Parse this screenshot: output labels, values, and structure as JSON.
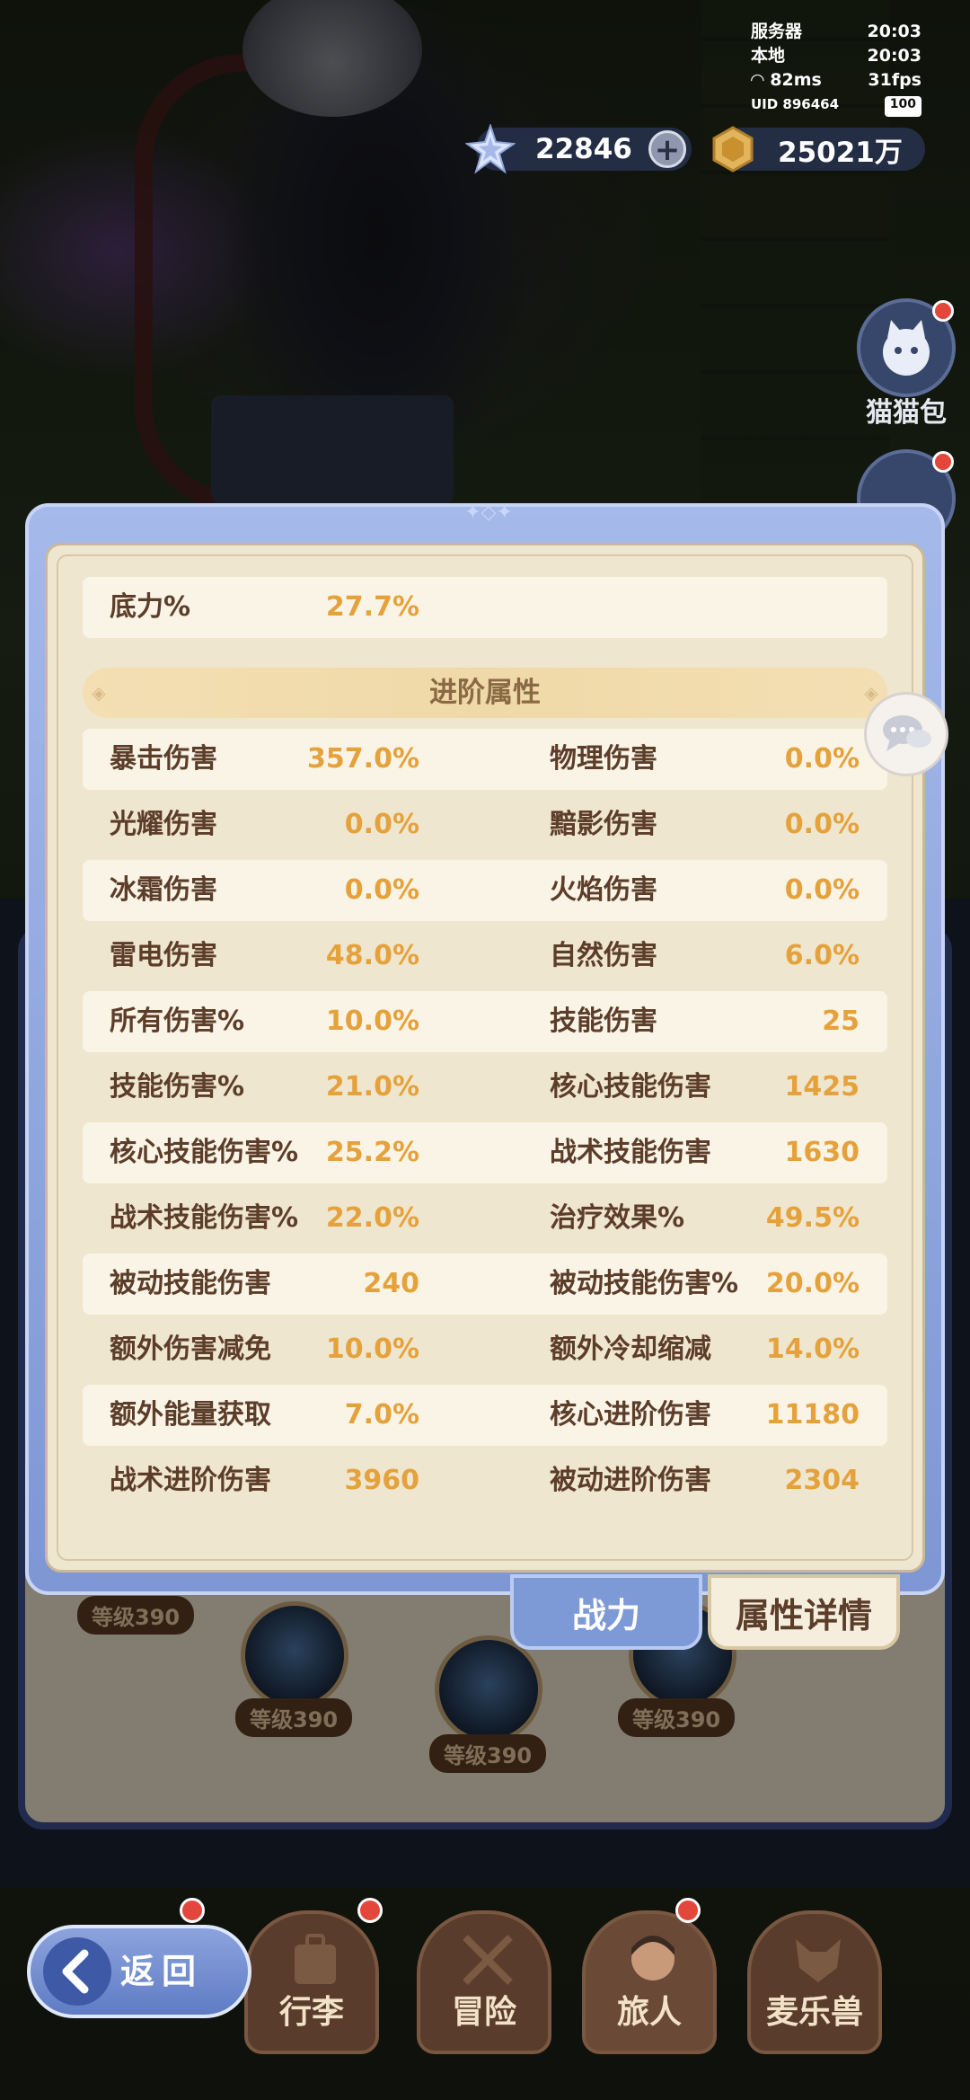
{
  "status": {
    "server_label": "服务器",
    "server_time": "20:03",
    "local_label": "本地",
    "local_time": "20:03",
    "ping": "82ms",
    "fps": "31fps",
    "uid": "UID 896464",
    "battery": "100"
  },
  "currency": {
    "gems": "22846",
    "coins": "25021万"
  },
  "side_buttons": {
    "cat_bag_label": "猫猫包"
  },
  "stats_panel": {
    "top_row": {
      "label": "底力%",
      "value": "27.7%"
    },
    "section_title": "进阶属性",
    "rows": [
      {
        "l1": "暴击伤害",
        "v1": "357.0%",
        "l2": "物理伤害",
        "v2": "0.0%"
      },
      {
        "l1": "光耀伤害",
        "v1": "0.0%",
        "l2": "黯影伤害",
        "v2": "0.0%"
      },
      {
        "l1": "冰霜伤害",
        "v1": "0.0%",
        "l2": "火焰伤害",
        "v2": "0.0%"
      },
      {
        "l1": "雷电伤害",
        "v1": "48.0%",
        "l2": "自然伤害",
        "v2": "6.0%"
      },
      {
        "l1": "所有伤害%",
        "v1": "10.0%",
        "l2": "技能伤害",
        "v2": "25"
      },
      {
        "l1": "技能伤害%",
        "v1": "21.0%",
        "l2": "核心技能伤害",
        "v2": "1425"
      },
      {
        "l1": "核心技能伤害%",
        "v1": "25.2%",
        "l2": "战术技能伤害",
        "v2": "1630"
      },
      {
        "l1": "战术技能伤害%",
        "v1": "22.0%",
        "l2": "治疗效果%",
        "v2": "49.5%"
      },
      {
        "l1": "被动技能伤害",
        "v1": "240",
        "l2": "被动技能伤害%",
        "v2": "20.0%"
      },
      {
        "l1": "额外伤害减免",
        "v1": "10.0%",
        "l2": "额外冷却缩减",
        "v2": "14.0%"
      },
      {
        "l1": "额外能量获取",
        "v1": "7.0%",
        "l2": "核心进阶伤害",
        "v2": "11180"
      },
      {
        "l1": "战术进阶伤害",
        "v1": "3960",
        "l2": "被动进阶伤害",
        "v2": "2304"
      }
    ]
  },
  "tabs": {
    "power": "战力",
    "attribute_details": "属性详情"
  },
  "background_badges": {
    "b1": "等级390",
    "b2": "等级390",
    "b3": "等级390",
    "b4": "等级390"
  },
  "nav": {
    "back": "返回",
    "luggage": "行李",
    "adventure": "冒险",
    "traveler": "旅人",
    "pets": "麦乐兽"
  },
  "colors": {
    "panel_bg": "#efe6cf",
    "label": "#5c3d2a",
    "value": "#e5a23c",
    "frame": "#7e97d4",
    "badge_red": "#e3473b"
  }
}
